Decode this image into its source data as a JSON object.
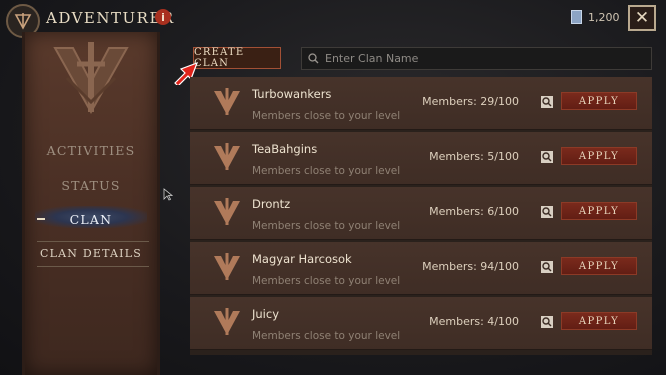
{
  "header": {
    "title": "ADVENTURER",
    "info_badge": "i",
    "currency_value": "1,200",
    "close_label": "✕"
  },
  "sidebar": {
    "items": [
      {
        "label": "ACTIVITIES",
        "active": false
      },
      {
        "label": "STATUS",
        "active": false
      },
      {
        "label": "CLAN",
        "active": true
      },
      {
        "label": "CLAN DETAILS",
        "active": false
      }
    ]
  },
  "toolbar": {
    "create_clan_label": "CREATE CLAN",
    "search_placeholder": "Enter Clan Name"
  },
  "clans": [
    {
      "name": "Turbowankers",
      "subtitle": "Members close to your level",
      "members": "Members: 29/100",
      "apply_label": "APPLY"
    },
    {
      "name": "TeaBahgins",
      "subtitle": "Members close to your level",
      "members": "Members: 5/100",
      "apply_label": "APPLY"
    },
    {
      "name": "Drontz",
      "subtitle": "Members close to your level",
      "members": "Members: 6/100",
      "apply_label": "APPLY"
    },
    {
      "name": "Magyar Harcosok",
      "subtitle": "Members close to your level",
      "members": "Members: 94/100",
      "apply_label": "APPLY"
    },
    {
      "name": "Juicy",
      "subtitle": "Members close to your level",
      "members": "Members: 4/100",
      "apply_label": "APPLY"
    }
  ],
  "colors": {
    "accent_red": "#a8301f",
    "banner": "#4b3025",
    "row_bg": "#47332a",
    "annotation_arrow": "#e0231a"
  }
}
